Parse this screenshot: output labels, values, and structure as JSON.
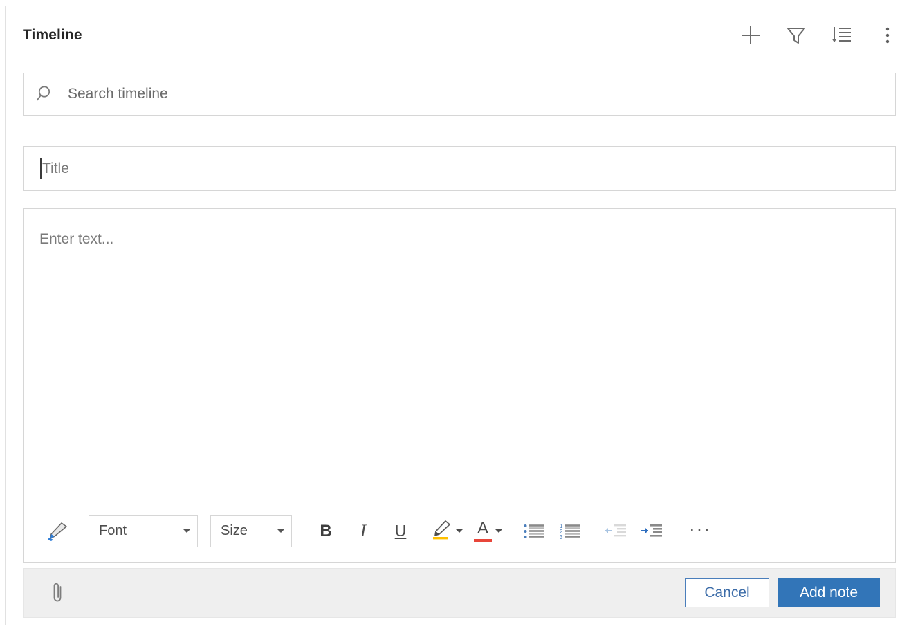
{
  "panel": {
    "title": "Timeline",
    "header_actions": [
      {
        "name": "add-icon",
        "label": "Add"
      },
      {
        "name": "filter-icon",
        "label": "Filter"
      },
      {
        "name": "sort-descending-icon",
        "label": "Sort"
      },
      {
        "name": "more-options-icon",
        "label": "More commands"
      }
    ]
  },
  "search": {
    "placeholder": "Search timeline",
    "value": "",
    "icon": "search-icon"
  },
  "note_form": {
    "title_field": {
      "placeholder": "Title",
      "value": "",
      "focused": true
    },
    "body_field": {
      "placeholder": "Enter text...",
      "value": ""
    },
    "format_toolbar": {
      "format_painter_label": "Format painter",
      "font": {
        "label": "Font",
        "value": ""
      },
      "size": {
        "label": "Size",
        "value": ""
      },
      "bold_label": "B",
      "italic_label": "I",
      "underline_label": "U",
      "highlight_label": "Text highlight color",
      "font_color_label": "A",
      "bulleted_list_label": "Bulleted list",
      "numbered_list_label": "Numbered list",
      "decrease_indent_label": "Decrease indent",
      "increase_indent_label": "Increase indent",
      "more_label": "···",
      "highlight_color": "#ffc000",
      "font_color": "#e8463a",
      "decrease_indent_disabled": true
    },
    "footer": {
      "attach_label": "Attach",
      "cancel_label": "Cancel",
      "submit_label": "Add note",
      "primary_color": "#3275b8",
      "cancel_border_color": "#4a7ebb"
    }
  }
}
